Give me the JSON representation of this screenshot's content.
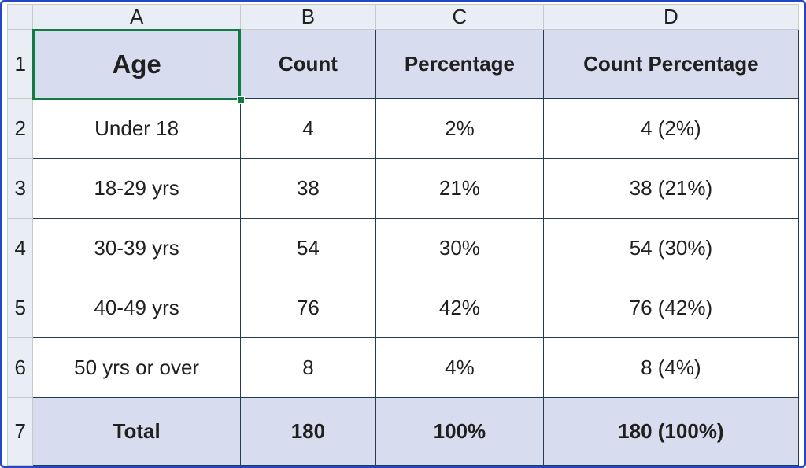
{
  "columns": [
    "A",
    "B",
    "C",
    "D"
  ],
  "rowNumbers": [
    "1",
    "2",
    "3",
    "4",
    "5",
    "6",
    "7"
  ],
  "headers": {
    "age": "Age",
    "count": "Count",
    "percentage": "Percentage",
    "countPercentage": "Count Percentage"
  },
  "rows": [
    {
      "age": "Under 18",
      "count": "4",
      "percentage": "2%",
      "countPercentage": "4 (2%)"
    },
    {
      "age": "18-29 yrs",
      "count": "38",
      "percentage": "21%",
      "countPercentage": "38 (21%)"
    },
    {
      "age": "30-39 yrs",
      "count": "54",
      "percentage": "30%",
      "countPercentage": "54 (30%)"
    },
    {
      "age": "40-49 yrs",
      "count": "76",
      "percentage": "42%",
      "countPercentage": "76 (42%)"
    },
    {
      "age": "50 yrs or over",
      "count": "8",
      "percentage": "4%",
      "countPercentage": "8 (4%)"
    }
  ],
  "totals": {
    "label": "Total",
    "count": "180",
    "percentage": "100%",
    "countPercentage": "180 (100%)"
  },
  "activeCell": "A1"
}
